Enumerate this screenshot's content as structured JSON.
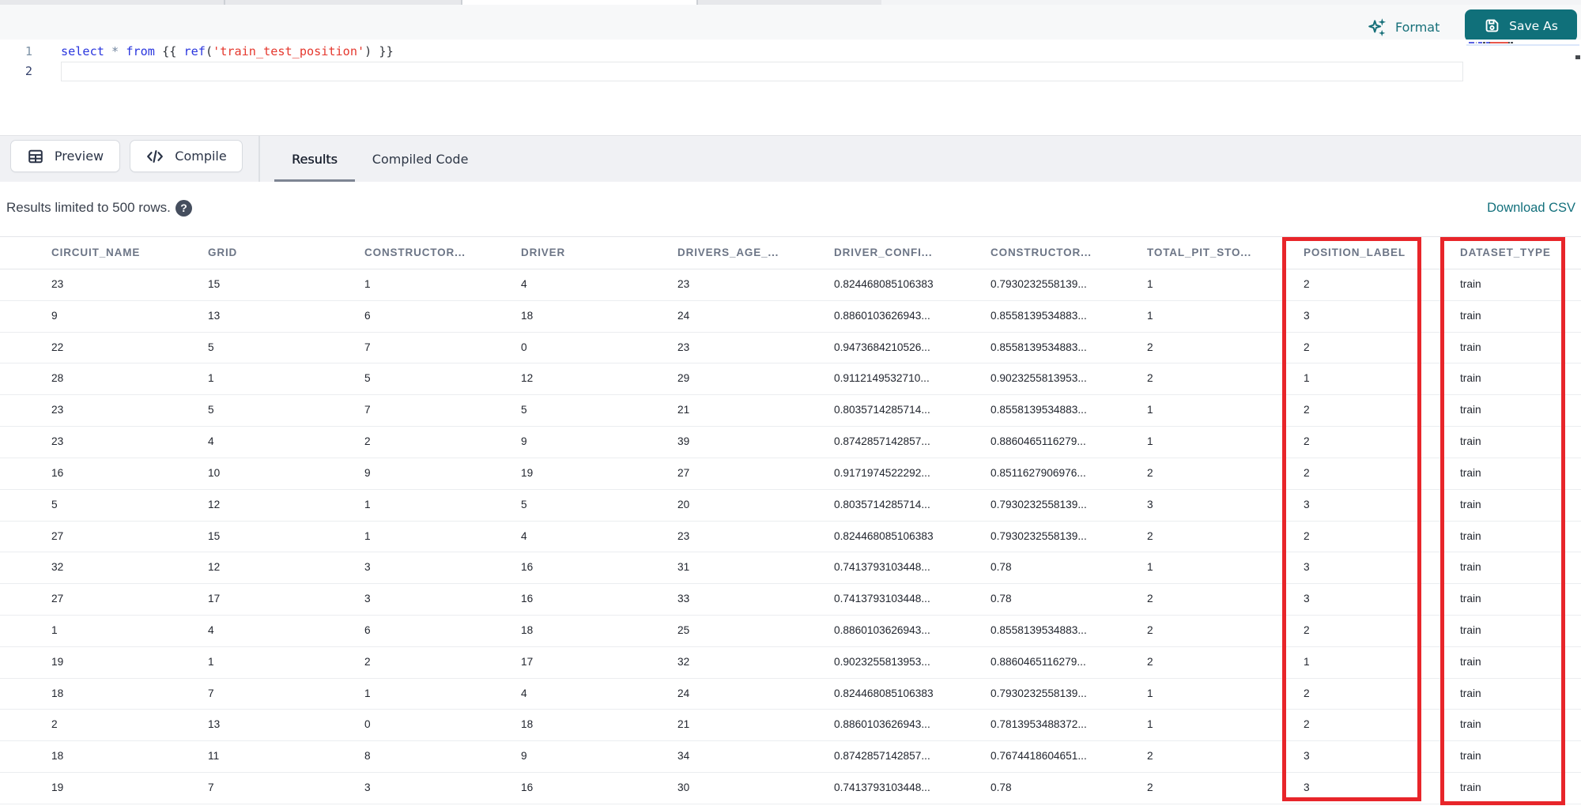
{
  "editor_toolbar": {
    "format_label": "Format",
    "save_as_label": "Save As"
  },
  "editor": {
    "lines": [
      {
        "number": "1",
        "tokens": [
          {
            "text": "select",
            "type": "keyword"
          },
          {
            "text": " ",
            "type": "plain"
          },
          {
            "text": "*",
            "type": "operator"
          },
          {
            "text": " ",
            "type": "plain"
          },
          {
            "text": "from",
            "type": "keyword"
          },
          {
            "text": " {{ ",
            "type": "plain"
          },
          {
            "text": "ref",
            "type": "keyword"
          },
          {
            "text": "(",
            "type": "plain"
          },
          {
            "text": "'train_test_position'",
            "type": "string"
          },
          {
            "text": ")",
            "type": "plain"
          },
          {
            "text": " }}",
            "type": "plain"
          }
        ]
      },
      {
        "number": "2",
        "tokens": []
      }
    ]
  },
  "action_bar": {
    "preview_label": "Preview",
    "compile_label": "Compile",
    "tabs": [
      {
        "label": "Results",
        "active": true
      },
      {
        "label": "Compiled Code",
        "active": false
      }
    ]
  },
  "results_meta": {
    "info": "Results limited to 500 rows.",
    "help_icon": "?",
    "download_label": "Download CSV"
  },
  "table": {
    "columns": [
      "CIRCUIT_NAME",
      "GRID",
      "CONSTRUCTOR...",
      "DRIVER",
      "DRIVERS_AGE_...",
      "DRIVER_CONFI...",
      "CONSTRUCTOR...",
      "TOTAL_PIT_STO...",
      "POSITION_LABEL",
      "DATASET_TYPE"
    ],
    "rows": [
      [
        "23",
        "15",
        "1",
        "4",
        "23",
        "0.824468085106383",
        "0.7930232558139...",
        "1",
        "2",
        "train"
      ],
      [
        "9",
        "13",
        "6",
        "18",
        "24",
        "0.8860103626943...",
        "0.8558139534883...",
        "1",
        "3",
        "train"
      ],
      [
        "22",
        "5",
        "7",
        "0",
        "23",
        "0.9473684210526...",
        "0.8558139534883...",
        "2",
        "2",
        "train"
      ],
      [
        "28",
        "1",
        "5",
        "12",
        "29",
        "0.9112149532710...",
        "0.9023255813953...",
        "2",
        "1",
        "train"
      ],
      [
        "23",
        "5",
        "7",
        "5",
        "21",
        "0.8035714285714...",
        "0.8558139534883...",
        "1",
        "2",
        "train"
      ],
      [
        "23",
        "4",
        "2",
        "9",
        "39",
        "0.8742857142857...",
        "0.8860465116279...",
        "1",
        "2",
        "train"
      ],
      [
        "16",
        "10",
        "9",
        "19",
        "27",
        "0.9171974522292...",
        "0.8511627906976...",
        "2",
        "2",
        "train"
      ],
      [
        "5",
        "12",
        "1",
        "5",
        "20",
        "0.8035714285714...",
        "0.7930232558139...",
        "3",
        "3",
        "train"
      ],
      [
        "27",
        "15",
        "1",
        "4",
        "23",
        "0.824468085106383",
        "0.7930232558139...",
        "2",
        "2",
        "train"
      ],
      [
        "32",
        "12",
        "3",
        "16",
        "31",
        "0.7413793103448...",
        "0.78",
        "1",
        "3",
        "train"
      ],
      [
        "27",
        "17",
        "3",
        "16",
        "33",
        "0.7413793103448...",
        "0.78",
        "2",
        "3",
        "train"
      ],
      [
        "1",
        "4",
        "6",
        "18",
        "25",
        "0.8860103626943...",
        "0.8558139534883...",
        "2",
        "2",
        "train"
      ],
      [
        "19",
        "1",
        "2",
        "17",
        "32",
        "0.9023255813953...",
        "0.8860465116279...",
        "2",
        "1",
        "train"
      ],
      [
        "18",
        "7",
        "1",
        "4",
        "24",
        "0.824468085106383",
        "0.7930232558139...",
        "1",
        "2",
        "train"
      ],
      [
        "2",
        "13",
        "0",
        "18",
        "21",
        "0.8860103626943...",
        "0.7813953488372...",
        "1",
        "2",
        "train"
      ],
      [
        "18",
        "11",
        "8",
        "9",
        "34",
        "0.8742857142857...",
        "0.7674418604651...",
        "2",
        "3",
        "train"
      ],
      [
        "19",
        "7",
        "3",
        "16",
        "30",
        "0.7413793103448...",
        "0.78",
        "2",
        "3",
        "train"
      ]
    ]
  },
  "annotations": {
    "highlighted_columns": [
      "POSITION_LABEL",
      "DATASET_TYPE"
    ],
    "highlight_color": "#e8252a"
  },
  "colors": {
    "accent_teal": "#10707a",
    "annotation_red": "#e8252a"
  }
}
